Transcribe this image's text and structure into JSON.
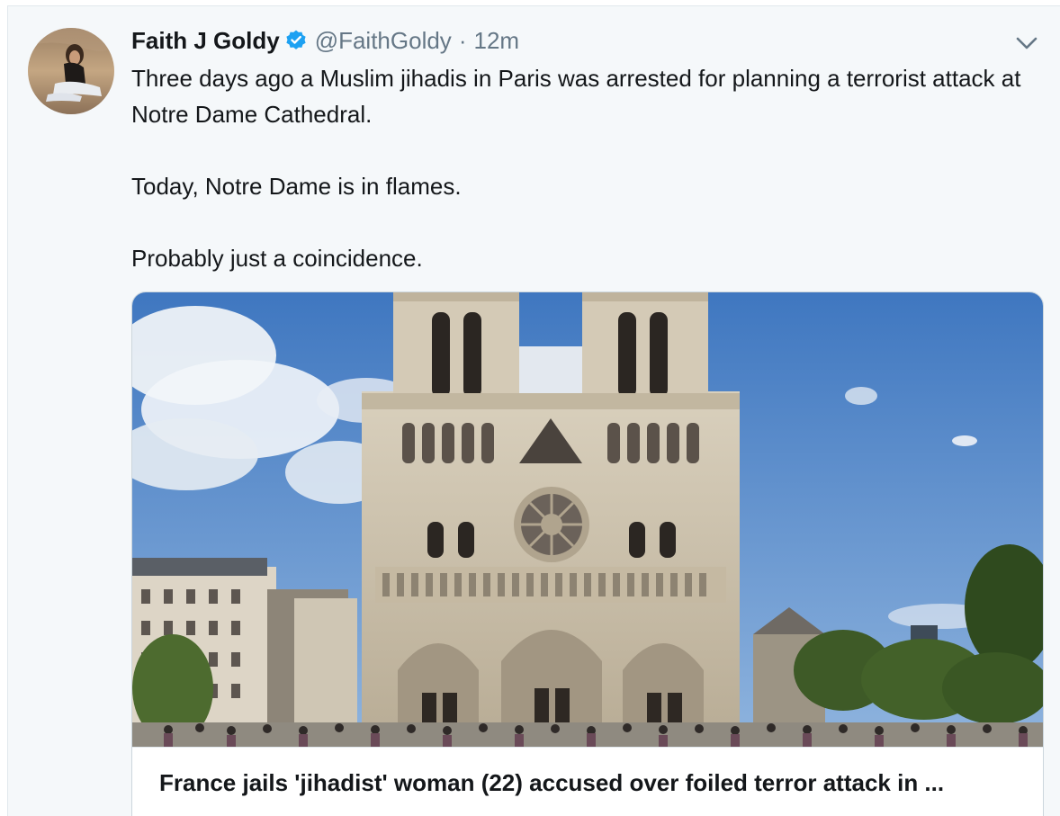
{
  "tweet": {
    "author_name": "Faith J Goldy",
    "verified_icon": "verified-badge-icon",
    "handle": "@FaithGoldy",
    "separator": "·",
    "timestamp": "12m",
    "menu_icon": "chevron-down-icon",
    "paragraphs": [
      "Three days ago a Muslim jihadis in Paris was arrested for planning a terrorist attack at Notre Dame Cathedral.",
      "Today, Notre Dame is in flames.",
      "Probably just a coincidence."
    ]
  },
  "card": {
    "title": "France jails 'jihadist' woman (22) accused over foiled terror attack in ..."
  },
  "colors": {
    "background": "#f5f8fa",
    "name": "#14171a",
    "secondary": "#657786",
    "verified": "#1da1f2",
    "sky": "#4f86c6"
  }
}
